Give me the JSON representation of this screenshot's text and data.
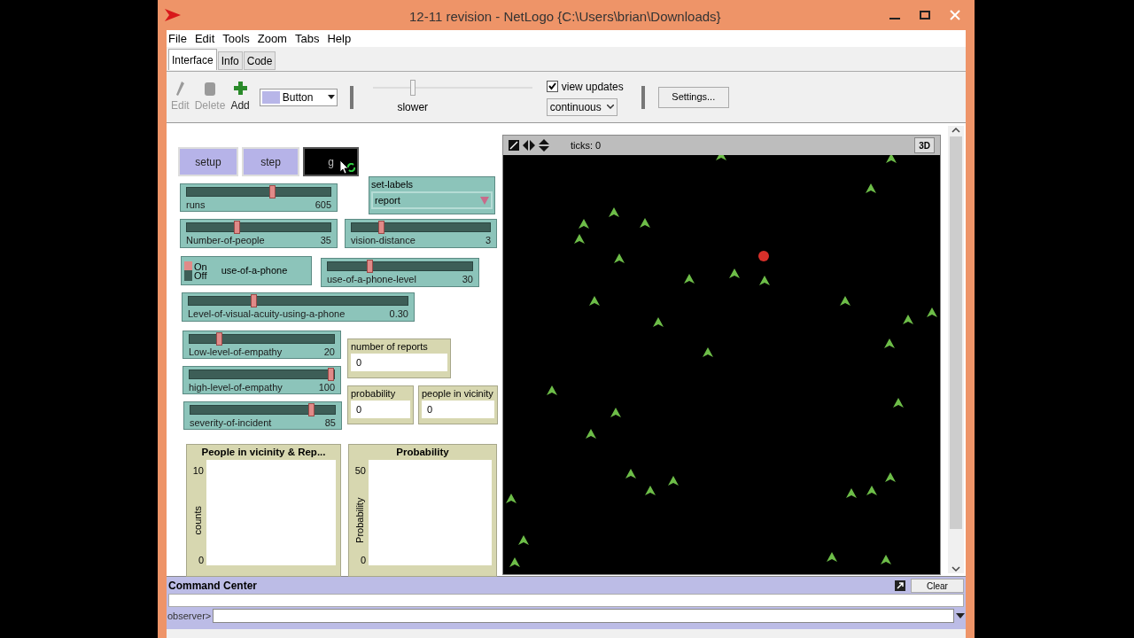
{
  "window": {
    "title": "12-11 revision - NetLogo {C:\\Users\\brian\\Downloads}"
  },
  "menu": [
    "File",
    "Edit",
    "Tools",
    "Zoom",
    "Tabs",
    "Help"
  ],
  "tabs": [
    {
      "label": "Interface",
      "selected": true
    },
    {
      "label": "Info",
      "selected": false
    },
    {
      "label": "Code",
      "selected": false
    }
  ],
  "toolbar": {
    "tools": [
      {
        "kind": "edit",
        "label": "Edit",
        "disabled": true
      },
      {
        "kind": "delete",
        "label": "Delete",
        "disabled": true
      },
      {
        "kind": "add",
        "label": "Add",
        "disabled": false
      }
    ],
    "widget_type": "Button",
    "speed": {
      "label": "slower",
      "level": 0.25
    },
    "view_updates": {
      "label": "view updates",
      "checked": true
    },
    "update_mode": "continuous",
    "settings": "Settings..."
  },
  "buttons": [
    {
      "label": "setup",
      "running": false,
      "forever": false
    },
    {
      "label": "step",
      "running": false,
      "forever": false
    },
    {
      "label": "g",
      "running": true,
      "forever": true
    }
  ],
  "sliders": [
    {
      "name": "runs",
      "value": "605",
      "level": 0.6
    },
    {
      "name": "Number-of-people",
      "value": "35",
      "level": 0.34
    },
    {
      "name": "vision-distance",
      "value": "3",
      "level": 0.2
    },
    {
      "name": "use-of-a-phone-level",
      "value": "30",
      "level": 0.28
    },
    {
      "name": "Level-of-visual-acuity-using-a-phone",
      "value": "0.30",
      "level": 0.29
    },
    {
      "name": "Low-level-of-empathy",
      "value": "20",
      "level": 0.19
    },
    {
      "name": "high-level-of-empathy",
      "value": "100",
      "level": 1
    },
    {
      "name": "severity-of-incident",
      "value": "85",
      "level": 0.85
    }
  ],
  "chooser": {
    "name": "set-labels",
    "value": "report"
  },
  "switch": {
    "on_label": "On",
    "off_label": "Off",
    "name": "use-of-a-phone",
    "on": true
  },
  "monitors": [
    {
      "name": "number of reports",
      "value": "0"
    },
    {
      "name": "probability",
      "value": "0"
    },
    {
      "name": "people in vicinity",
      "value": "0"
    }
  ],
  "plots": [
    {
      "title": "People in vicinity & Rep...",
      "ylabel": "counts",
      "ymax": "10",
      "ymin": "0"
    },
    {
      "title": "Probability",
      "ylabel": "Probability",
      "ymax": "50",
      "ymin": "0"
    }
  ],
  "view": {
    "ticks_label": "ticks: 0",
    "three_d": "3D"
  },
  "command_center": {
    "title": "Command Center",
    "clear": "Clear",
    "prompt": "observer>"
  }
}
